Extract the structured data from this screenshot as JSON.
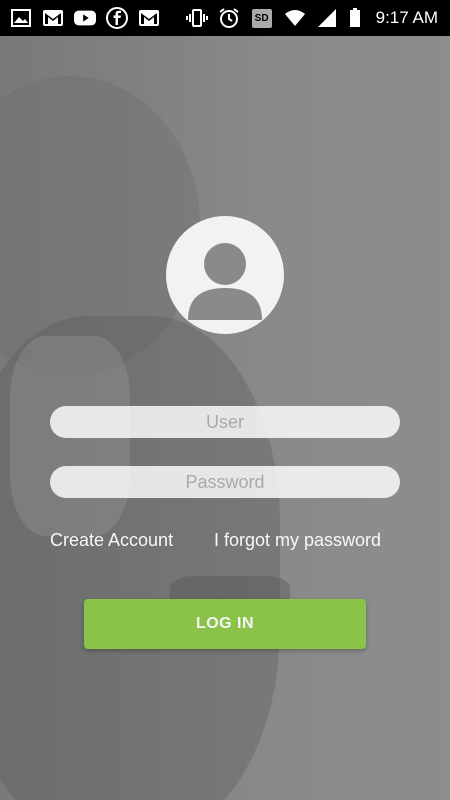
{
  "status_bar": {
    "left_icons": [
      "image-icon",
      "gmail-icon",
      "youtube-icon",
      "facebook-icon",
      "gmail-icon"
    ],
    "right_icons": [
      "vibrate-icon",
      "alarm-icon",
      "sd-card-icon",
      "wifi-icon",
      "signal-icon",
      "battery-icon"
    ],
    "sd_label": "SD",
    "time": "9:17 AM"
  },
  "login": {
    "avatar_icon": "user-avatar-icon",
    "user_placeholder": "User",
    "password_placeholder": "Password",
    "create_account": "Create Account",
    "forgot_password": "I forgot my password",
    "login_button": "LOG IN",
    "accent_color": "#8bc34a"
  }
}
